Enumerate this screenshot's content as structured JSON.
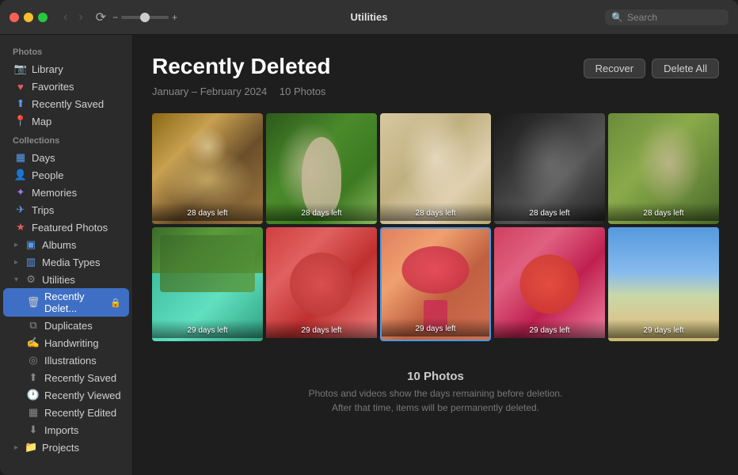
{
  "window": {
    "title": "Utilities"
  },
  "titlebar": {
    "back_label": "‹",
    "rotate_icon": "⟳",
    "zoom_minus": "−",
    "zoom_plus": "+",
    "search_placeholder": "Search"
  },
  "sidebar": {
    "photos_section": "Photos",
    "collections_section": "Collections",
    "items": {
      "library": "Library",
      "favorites": "Favorites",
      "recently_saved": "Recently Saved",
      "map": "Map",
      "days": "Days",
      "people": "People",
      "memories": "Memories",
      "trips": "Trips",
      "featured_photos": "Featured Photos",
      "albums": "Albums",
      "media_types": "Media Types",
      "utilities": "Utilities",
      "recently_deleted": "Recently Delet...",
      "duplicates": "Duplicates",
      "handwriting": "Handwriting",
      "illustrations": "Illustrations",
      "recently_saved_sub": "Recently Saved",
      "recently_viewed": "Recently Viewed",
      "recently_edited": "Recently Edited",
      "imports": "Imports",
      "projects": "Projects"
    }
  },
  "content": {
    "title": "Recently Deleted",
    "date_range": "January – February 2024",
    "photo_count": "10 Photos",
    "recover_btn": "Recover",
    "delete_all_btn": "Delete All",
    "footer_count": "10 Photos",
    "footer_desc_line1": "Photos and videos show the days remaining before deletion.",
    "footer_desc_line2": "After that time, items will be permanently deleted."
  },
  "photos": [
    {
      "id": "p1",
      "days_label": "28 days left",
      "class": "photo-1"
    },
    {
      "id": "p2",
      "days_label": "28 days left",
      "class": "photo-2"
    },
    {
      "id": "p3",
      "days_label": "28 days left",
      "class": "photo-3"
    },
    {
      "id": "p4",
      "days_label": "28 days left",
      "class": "photo-4"
    },
    {
      "id": "p5",
      "days_label": "28 days left",
      "class": "photo-5"
    },
    {
      "id": "p6",
      "days_label": "29 days left",
      "class": "photo-6"
    },
    {
      "id": "p7",
      "days_label": "29 days left",
      "class": "photo-7"
    },
    {
      "id": "p8",
      "days_label": "29 days left",
      "class": "photo-8"
    },
    {
      "id": "p9",
      "days_label": "29 days left",
      "class": "photo-9"
    },
    {
      "id": "p10",
      "days_label": "29 days left",
      "class": "photo-11"
    }
  ],
  "icons": {
    "library": "📷",
    "favorites": "♥",
    "saved": "⬆",
    "map": "📍",
    "days": "📅",
    "people": "👤",
    "memories": "✦",
    "trips": "✈",
    "featured": "★",
    "albums": "▣",
    "mediatypes": "▥",
    "utilities": "⚙",
    "trash": "🗑",
    "duplicates": "⧉",
    "handwriting": "✍",
    "illustrations": "◎",
    "clock": "🕐",
    "imports": "⬇",
    "folder": "📁",
    "expand": "▸",
    "collapse": "▾",
    "search": "🔍",
    "back": "‹",
    "forward": "›"
  }
}
